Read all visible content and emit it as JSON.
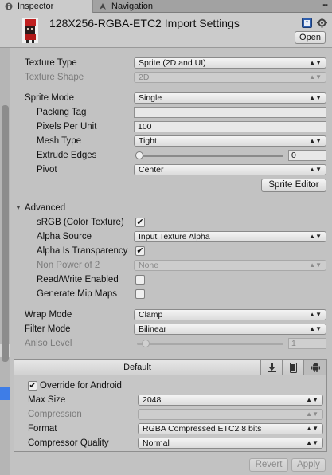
{
  "tabs": [
    {
      "label": "Inspector",
      "icon": "info-icon",
      "active": true
    },
    {
      "label": "Navigation",
      "icon": "navigation-icon",
      "active": false
    }
  ],
  "header": {
    "title": "128X256-RGBA-ETC2 Import Settings",
    "open_label": "Open"
  },
  "fields": {
    "texture_type": {
      "label": "Texture Type",
      "value": "Sprite (2D and UI)"
    },
    "texture_shape": {
      "label": "Texture Shape",
      "value": "2D"
    },
    "sprite_mode": {
      "label": "Sprite Mode",
      "value": "Single"
    },
    "packing_tag": {
      "label": "Packing Tag",
      "value": ""
    },
    "pixels_per_unit": {
      "label": "Pixels Per Unit",
      "value": "100"
    },
    "mesh_type": {
      "label": "Mesh Type",
      "value": "Tight"
    },
    "extrude_edges": {
      "label": "Extrude Edges",
      "value": "0",
      "slider_fraction": 0.0
    },
    "pivot": {
      "label": "Pivot",
      "value": "Center"
    },
    "sprite_editor_label": "Sprite Editor"
  },
  "advanced": {
    "label": "Advanced",
    "srgb": {
      "label": "sRGB (Color Texture)",
      "checked": true
    },
    "alpha_source": {
      "label": "Alpha Source",
      "value": "Input Texture Alpha"
    },
    "alpha_is_transparency": {
      "label": "Alpha Is Transparency",
      "checked": true
    },
    "non_power_of_2": {
      "label": "Non Power of 2",
      "value": "None"
    },
    "read_write": {
      "label": "Read/Write Enabled",
      "checked": false
    },
    "generate_mip_maps": {
      "label": "Generate Mip Maps",
      "checked": false
    }
  },
  "wrap_mode": {
    "label": "Wrap Mode",
    "value": "Clamp"
  },
  "filter_mode": {
    "label": "Filter Mode",
    "value": "Bilinear"
  },
  "aniso_level": {
    "label": "Aniso Level",
    "value": "1",
    "slider_fraction": 0.0
  },
  "platform": {
    "tabs": [
      {
        "label": "Default",
        "selected": false
      },
      {
        "icon": "download-icon",
        "selected": false
      },
      {
        "icon": "mobile-phone-icon",
        "selected": false
      },
      {
        "icon": "android-icon",
        "selected": true
      }
    ],
    "override": {
      "label": "Override for Android",
      "checked": true
    },
    "max_size": {
      "label": "Max Size",
      "value": "2048"
    },
    "compression": {
      "label": "Compression",
      "value": ""
    },
    "format": {
      "label": "Format",
      "value": "RGBA Compressed ETC2 8 bits"
    },
    "compressor_quality": {
      "label": "Compressor Quality",
      "value": "Normal"
    }
  },
  "footer": {
    "revert_label": "Revert",
    "apply_label": "Apply"
  },
  "colors": {
    "selection_blue": "#3e7de7",
    "panel_bg": "#c2c2c2"
  }
}
